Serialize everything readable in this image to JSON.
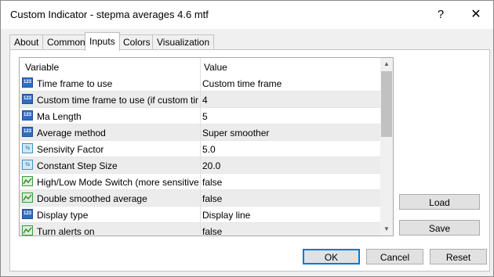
{
  "window": {
    "title": "Custom Indicator - stepma averages 4.6 mtf",
    "help_glyph": "?",
    "close_glyph": "✕"
  },
  "tabs": [
    {
      "label": "About"
    },
    {
      "label": "Common"
    },
    {
      "label": "Inputs",
      "active": true
    },
    {
      "label": "Colors"
    },
    {
      "label": "Visualization"
    }
  ],
  "grid": {
    "columns": {
      "variable": "Variable",
      "value": "Value"
    },
    "rows": [
      {
        "type_icon": "int-icon",
        "type_glyph": "123",
        "variable": "Time frame to use",
        "value": "Custom time frame"
      },
      {
        "type_icon": "int-icon",
        "type_glyph": "123",
        "variable": "Custom time frame to use (if custom time f...",
        "value": "4"
      },
      {
        "type_icon": "int-icon",
        "type_glyph": "123",
        "variable": "Ma Length",
        "value": "5"
      },
      {
        "type_icon": "int-icon",
        "type_glyph": "123",
        "variable": "Average method",
        "value": "Super smoother"
      },
      {
        "type_icon": "double-icon",
        "type_glyph": "½",
        "variable": "Sensivity Factor",
        "value": "5.0"
      },
      {
        "type_icon": "double-icon",
        "type_glyph": "½",
        "variable": "Constant Step Size",
        "value": "20.0"
      },
      {
        "type_icon": "bool-icon",
        "type_glyph": "",
        "variable": "High/Low Mode Switch (more sensitive)",
        "value": "false"
      },
      {
        "type_icon": "bool-icon",
        "type_glyph": "",
        "variable": "Double smoothed average",
        "value": "false"
      },
      {
        "type_icon": "int-icon",
        "type_glyph": "123",
        "variable": "Display type",
        "value": "Display line"
      },
      {
        "type_icon": "bool-icon",
        "type_glyph": "",
        "variable": "Turn alerts on",
        "value": "false"
      }
    ],
    "scroll_up_glyph": "▲",
    "scroll_down_glyph": "▼"
  },
  "side_buttons": {
    "load": "Load",
    "save": "Save"
  },
  "footer": {
    "ok": "OK",
    "cancel": "Cancel",
    "reset": "Reset"
  },
  "colors": {
    "accent": "#0078d7",
    "int_icon": "#2f6fc2",
    "bool_icon": "#3d9a3a",
    "double_icon": "#4a8fc0"
  }
}
